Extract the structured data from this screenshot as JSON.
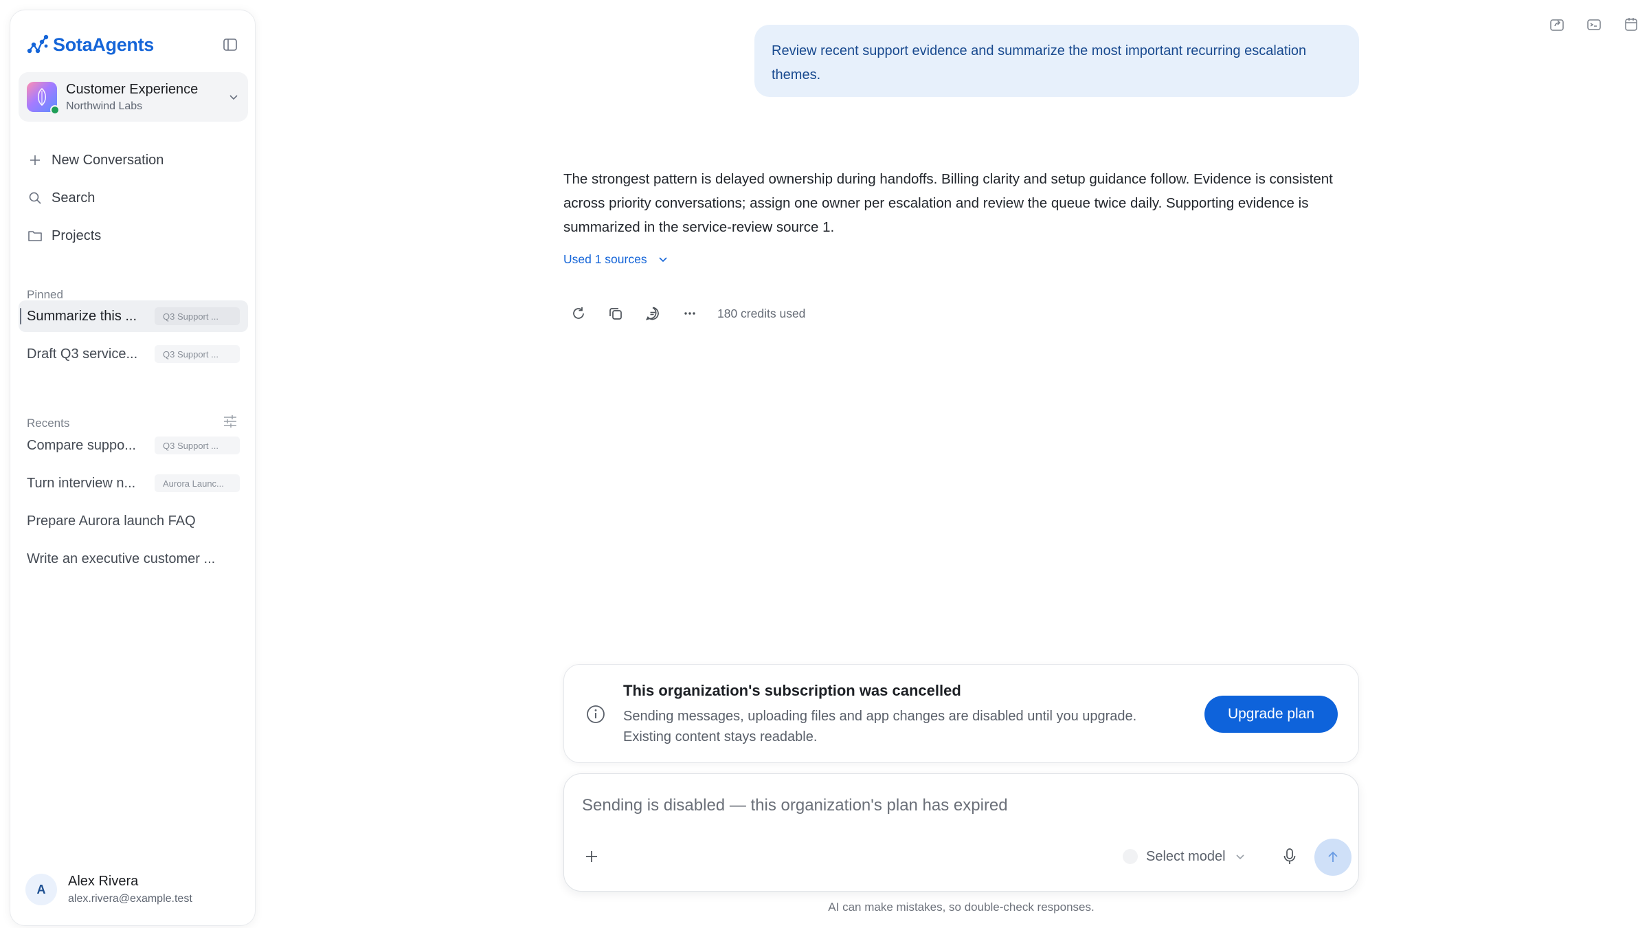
{
  "brand": {
    "name": "SotaAgents",
    "color": "#1565d8"
  },
  "workspace": {
    "name": "Customer Experience",
    "org": "Northwind Labs",
    "status_color": "#1e9e57"
  },
  "nav": [
    {
      "label": "New Conversation",
      "icon": "plus-icon"
    },
    {
      "label": "Search",
      "icon": "search-icon"
    },
    {
      "label": "Projects",
      "icon": "folder-icon"
    }
  ],
  "pinned": {
    "label": "Pinned",
    "items": [
      {
        "title": "Summarize this ...",
        "tag": "Q3 Support ...",
        "active": true
      },
      {
        "title": "Draft Q3 service...",
        "tag": "Q3 Support ..."
      }
    ]
  },
  "recents": {
    "label": "Recents",
    "items": [
      {
        "title": "Compare suppo...",
        "tag": "Q3 Support ..."
      },
      {
        "title": "Turn interview n...",
        "tag": "Aurora Launc..."
      },
      {
        "title": "Prepare Aurora launch FAQ"
      },
      {
        "title": "Write an executive customer ..."
      }
    ]
  },
  "user": {
    "initial": "A",
    "name": "Alex Rivera",
    "email": "alex.rivera@example.test"
  },
  "conversation": {
    "user_message": "Review recent support evidence and summarize the most important recurring escalation themes.",
    "assistant_message": "The strongest pattern is delayed ownership during handoffs. Billing clarity and setup guidance follow. Evidence is consistent across priority conversations; assign one owner per escalation and review the queue twice daily. Supporting evidence is summarized in the service-review source 1.",
    "sources_label": "Used 1 sources",
    "credits": "180 credits used"
  },
  "banner": {
    "title": "This organization's subscription was cancelled",
    "body": "Sending messages, uploading files and app changes are disabled until you upgrade. Existing content stays readable.",
    "button": "Upgrade plan",
    "button_color": "#0e63db"
  },
  "composer": {
    "placeholder": "Sending is disabled — this organization's plan has expired",
    "model_label": "Select model"
  },
  "disclaimer": "AI can make mistakes, so double-check responses."
}
